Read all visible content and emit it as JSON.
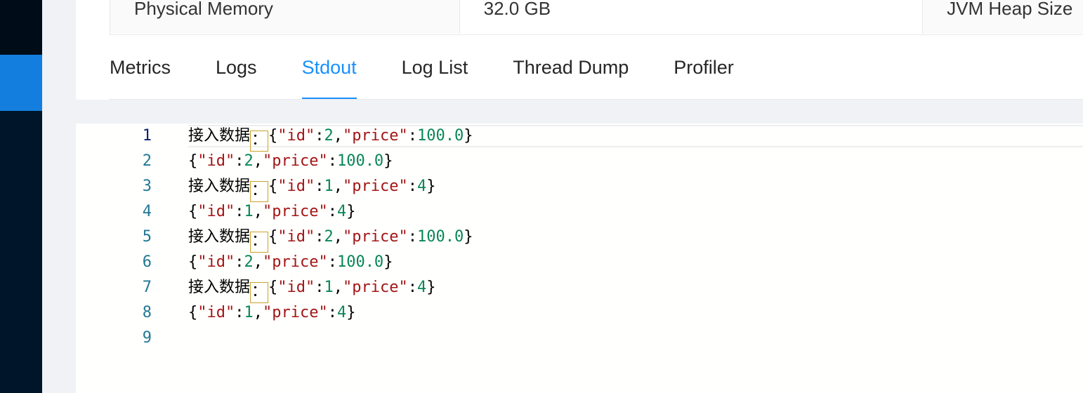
{
  "info": {
    "label1": "Physical Memory",
    "value1": "32.0 GB",
    "label2": "JVM Heap Size"
  },
  "tabs": [
    {
      "label": "Metrics",
      "active": false
    },
    {
      "label": "Logs",
      "active": false
    },
    {
      "label": "Stdout",
      "active": true
    },
    {
      "label": "Log List",
      "active": false
    },
    {
      "label": "Thread Dump",
      "active": false
    },
    {
      "label": "Profiler",
      "active": false
    }
  ],
  "colors": {
    "accent": "#1890ff",
    "sidebar": "#001529",
    "json_key": "#a31515",
    "json_number": "#098658",
    "line_number": "#237893"
  },
  "stdout": {
    "prefix": "接入数据",
    "prefix_colon": "：",
    "lines": [
      {
        "n": "1",
        "prefixed": true,
        "id": "2",
        "price": "100.0"
      },
      {
        "n": "2",
        "prefixed": false,
        "id": "2",
        "price": "100.0"
      },
      {
        "n": "3",
        "prefixed": true,
        "id": "1",
        "price": "4"
      },
      {
        "n": "4",
        "prefixed": false,
        "id": "1",
        "price": "4"
      },
      {
        "n": "5",
        "prefixed": true,
        "id": "2",
        "price": "100.0"
      },
      {
        "n": "6",
        "prefixed": false,
        "id": "2",
        "price": "100.0"
      },
      {
        "n": "7",
        "prefixed": true,
        "id": "1",
        "price": "4"
      },
      {
        "n": "8",
        "prefixed": false,
        "id": "1",
        "price": "4"
      },
      {
        "n": "9",
        "empty": true
      }
    ]
  }
}
